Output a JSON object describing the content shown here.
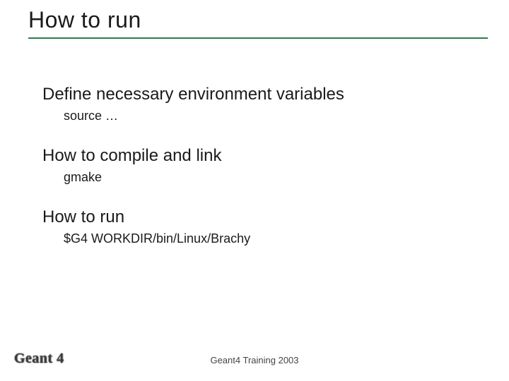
{
  "title": "How to run",
  "sections": [
    {
      "heading": "Define necessary environment variables",
      "sub": "source …"
    },
    {
      "heading": "How to compile and link",
      "sub": "gmake"
    },
    {
      "heading": "How to run",
      "sub": "$G4 WORKDIR/bin/Linux/Brachy"
    }
  ],
  "footer": {
    "logo": "Geant 4",
    "text": "Geant4 Training 2003"
  }
}
